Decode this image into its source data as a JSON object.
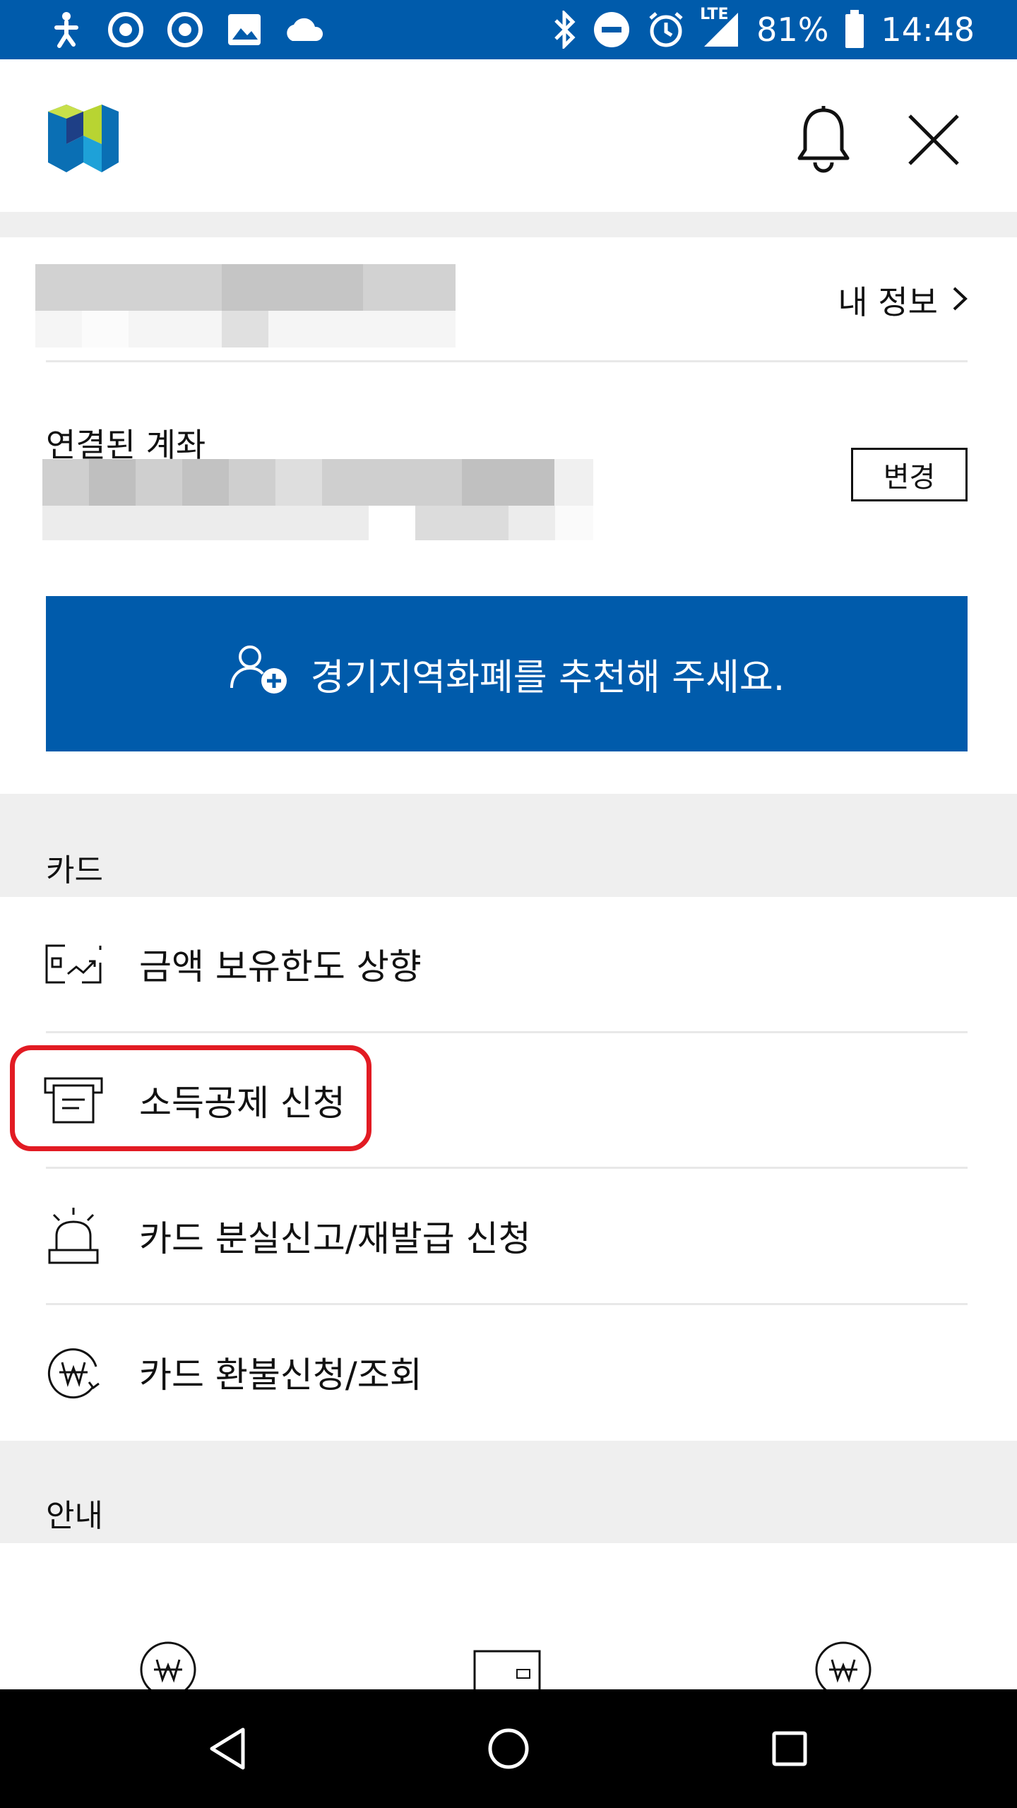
{
  "status_bar": {
    "battery_percent": "81%",
    "time": "14:48",
    "network": "LTE",
    "left_icons": [
      "accessibility-icon",
      "sync-icon",
      "sync-icon",
      "image-icon",
      "cloud-icon"
    ],
    "right_icons": [
      "bluetooth-icon",
      "do-not-disturb-icon",
      "alarm-icon",
      "signal-icon",
      "battery-icon"
    ]
  },
  "header": {
    "logo": "app-logo",
    "notifications_icon": "bell-icon",
    "close_icon": "close-icon"
  },
  "profile": {
    "my_info_label": "내 정보"
  },
  "account": {
    "linked_label": "연결된 계좌",
    "change_label": "변경"
  },
  "recommend": {
    "label": "경기지역화폐를 추천해 주세요.",
    "icon": "add-user-icon"
  },
  "sections": {
    "card_title": "카드",
    "info_title": "안내"
  },
  "card_menu": [
    {
      "label": "금액 보유한도 상향",
      "icon": "limit-chart-icon"
    },
    {
      "label": "소득공제 신청",
      "icon": "receipt-icon"
    },
    {
      "label": "카드 분실신고/재발급 신청",
      "icon": "siren-icon"
    },
    {
      "label": "카드 환불신청/조회",
      "icon": "won-refund-icon"
    }
  ],
  "colors": {
    "status_bar": "#005bab",
    "primary": "#005bab",
    "highlight": "#e21b23",
    "section_bg": "#efefef"
  }
}
